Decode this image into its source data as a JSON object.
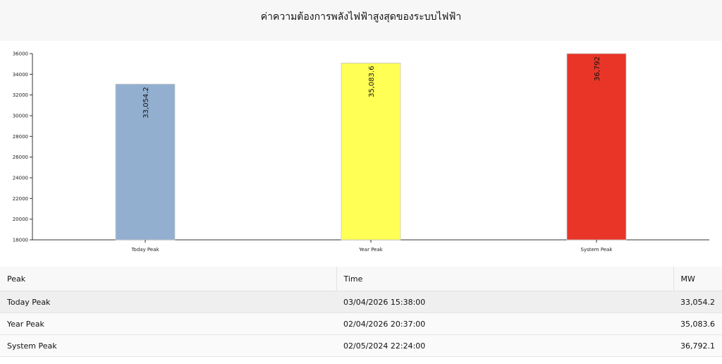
{
  "header": {
    "title": "ค่าความต้องการพลังไฟฟ้าสูงสุดของระบบไฟฟ้า"
  },
  "chart_data": {
    "type": "bar",
    "categories": [
      "Today Peak",
      "Year Peak",
      "System Peak"
    ],
    "values": [
      33054.2,
      35083.6,
      36792.1
    ],
    "value_labels": [
      "33,054.2",
      "35,083.6",
      "36,792"
    ],
    "colors": [
      "#92afd0",
      "#ffff55",
      "#e83527"
    ],
    "ylim": [
      18000,
      36000
    ],
    "yticks": [
      18000,
      20000,
      22000,
      24000,
      26000,
      28000,
      30000,
      32000,
      34000,
      36000
    ],
    "title": "",
    "xlabel": "",
    "ylabel": "",
    "grid": false
  },
  "table": {
    "headers": [
      "Peak",
      "Time",
      "MW"
    ],
    "rows": [
      [
        "Today Peak",
        "03/04/2026  15:38:00",
        "33,054.2"
      ],
      [
        "Year Peak",
        "02/04/2026  20:37:00",
        "35,083.6"
      ],
      [
        "System Peak",
        "02/05/2024  22:24:00",
        "36,792.1"
      ]
    ]
  }
}
